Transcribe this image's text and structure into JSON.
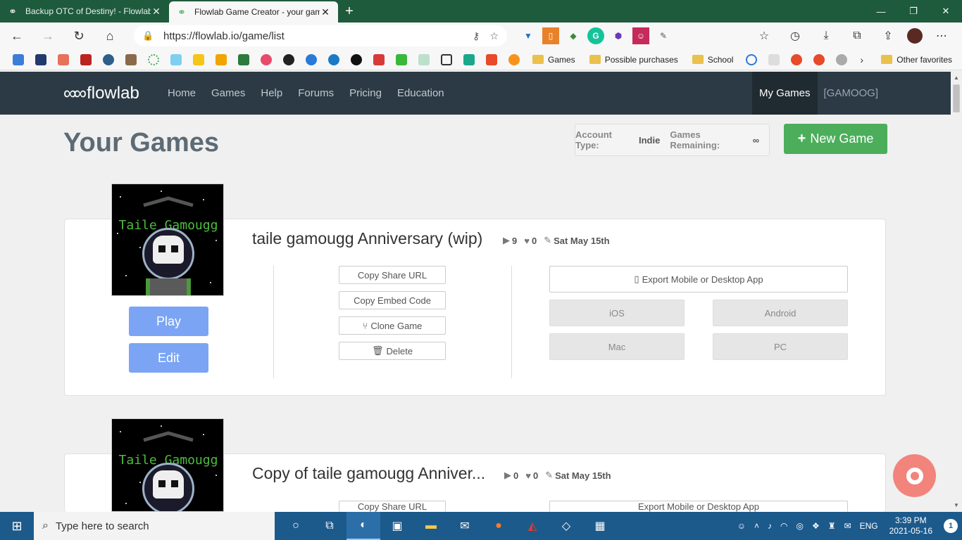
{
  "browser": {
    "tabs": [
      {
        "title": "Backup OTC of Destiny! - Flowlab",
        "active": false
      },
      {
        "title": "Flowlab Game Creator - your gam",
        "active": true
      }
    ],
    "url": "https://flowlab.io/game/list",
    "bookmarks": {
      "folders": [
        "Games",
        "Possible purchases",
        "School"
      ],
      "other": "Other favorites"
    }
  },
  "site": {
    "logo_text": "flowlab",
    "nav": [
      "Home",
      "Games",
      "Help",
      "Forums",
      "Pricing",
      "Education"
    ],
    "my_games": "My Games",
    "user": "[GAMOOG]"
  },
  "page": {
    "title": "Your Games",
    "account_type_label": "Account Type:",
    "account_type_value": "Indie",
    "games_remaining_label": "Games Remaining:",
    "games_remaining_value": "∞",
    "new_game_label": "New Game"
  },
  "games": [
    {
      "title": "taile gamougg Anniversary (wip)",
      "thumb_title": "Taile Gamougg",
      "plays": "9",
      "likes": "0",
      "date": "Sat May 15th",
      "play_label": "Play",
      "edit_label": "Edit",
      "copy_share": "Copy Share URL",
      "copy_embed": "Copy Embed Code",
      "clone": "Clone Game",
      "delete": "Delete",
      "export": "Export Mobile or Desktop App",
      "platforms": [
        "iOS",
        "Android",
        "Mac",
        "PC"
      ]
    },
    {
      "title": "Copy of taile gamougg Anniver...",
      "thumb_title": "Taile Gamougg",
      "plays": "0",
      "likes": "0",
      "date": "Sat May 15th",
      "copy_share": "Copy Share URL",
      "export": "Export Mobile or Desktop App"
    }
  ],
  "taskbar": {
    "search_placeholder": "Type here to search",
    "language": "ENG",
    "time": "3:39 PM",
    "date": "2021-05-16",
    "notifications": "1"
  }
}
